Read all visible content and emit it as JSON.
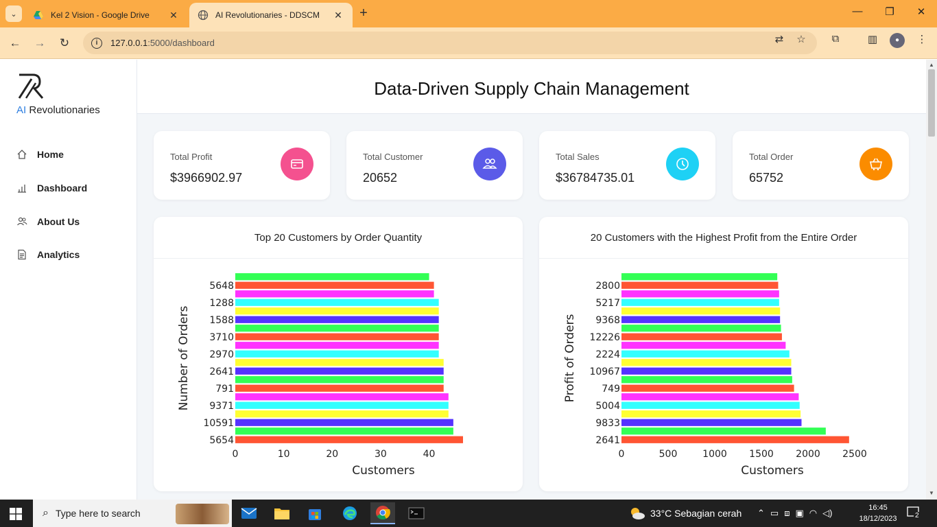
{
  "browser": {
    "tabs": [
      {
        "title": "Kel 2 Vision - Google Drive",
        "active": false
      },
      {
        "title": "AI Revolutionaries - DDSCM",
        "active": true
      }
    ],
    "url_host": "127.0.0.1",
    "url_path": ":5000/dashboard"
  },
  "sidebar": {
    "brand_ai": "AI",
    "brand_rest": " Revolutionaries",
    "items": [
      {
        "label": "Home"
      },
      {
        "label": "Dashboard"
      },
      {
        "label": "About Us"
      },
      {
        "label": "Analytics"
      }
    ]
  },
  "header": {
    "title": "Data-Driven Supply Chain Management"
  },
  "stats": [
    {
      "label": "Total Profit",
      "value": "$3966902.97",
      "color": "#f4518f",
      "icon": "credit-card-icon"
    },
    {
      "label": "Total Customer",
      "value": "20652",
      "color": "#5b5be8",
      "icon": "users-icon"
    },
    {
      "label": "Total Sales",
      "value": "$36784735.01",
      "color": "#1ed1f5",
      "icon": "clock-icon"
    },
    {
      "label": "Total Order",
      "value": "65752",
      "color": "#fb8c00",
      "icon": "basket-icon"
    }
  ],
  "chart_data": [
    {
      "type": "bar",
      "orientation": "horizontal",
      "title": "Top 20 Customers by Order Quantity",
      "xlabel": "Customers",
      "ylabel": "Number of Orders",
      "xlim": [
        0,
        47
      ],
      "xticks": [
        0,
        10,
        20,
        30,
        40
      ],
      "ytick_labels": [
        "5654",
        "10591",
        "9371",
        "791",
        "2641",
        "2970",
        "3710",
        "1588",
        "1288",
        "5648"
      ],
      "values": [
        47,
        45,
        45,
        44,
        44,
        44,
        43,
        43,
        43,
        43,
        42,
        42,
        42,
        42,
        42,
        42,
        42,
        41,
        41,
        40
      ],
      "colors": [
        "#ff5533",
        "#33ff55",
        "#5533ff",
        "#ffff33",
        "#33ffff",
        "#ff33ff"
      ]
    },
    {
      "type": "bar",
      "orientation": "horizontal",
      "title": "20 Customers with the Highest Profit from the Entire Order",
      "xlabel": "Customers",
      "ylabel": "Profit of Orders",
      "xlim": [
        0,
        2500
      ],
      "xticks": [
        0,
        500,
        1000,
        1500,
        2000,
        2500
      ],
      "ytick_labels": [
        "2641",
        "9833",
        "5004",
        "749",
        "10967",
        "2224",
        "12226",
        "9368",
        "5217",
        "2800"
      ],
      "values": [
        2440,
        2190,
        1930,
        1920,
        1910,
        1900,
        1850,
        1830,
        1820,
        1820,
        1800,
        1760,
        1720,
        1710,
        1700,
        1700,
        1690,
        1690,
        1680,
        1670
      ],
      "colors": [
        "#ff5533",
        "#33ff55",
        "#5533ff",
        "#ffff33",
        "#33ffff",
        "#ff33ff"
      ]
    }
  ],
  "taskbar": {
    "search_placeholder": "Type here to search",
    "weather": "33°C  Sebagian cerah",
    "time": "16:45",
    "date": "18/12/2023",
    "notifications": "2"
  }
}
